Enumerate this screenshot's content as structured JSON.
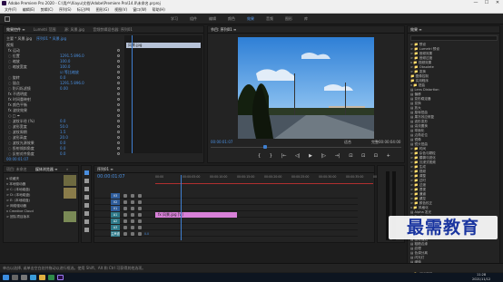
{
  "window": {
    "title": "Adobe Premiere Pro 2020 - C:\\用户\\Xiayu\\文档\\Adobe\\Premiere Pro\\14.0\\未命名.prproj",
    "minimize": "—",
    "maximize": "☐",
    "close": "✕"
  },
  "menu": [
    "文件(F)",
    "编辑(E)",
    "剪辑(C)",
    "序列(S)",
    "标记(M)",
    "图形(G)",
    "视图(V)",
    "窗口(W)",
    "帮助(H)"
  ],
  "workspaces": {
    "items": [
      "学习",
      "组件",
      "编辑",
      "颜色",
      "效果",
      "音频",
      "图形",
      "库"
    ],
    "active": 4
  },
  "effect_controls": {
    "tabs": [
      "效果控件 ≡",
      "Lumetri 范围",
      "源: 风景.jpg",
      "音频剪辑混合器: 序列01"
    ],
    "header": [
      "主要 * 风景.jpg",
      "序列01 * 风景.jpg"
    ],
    "clip_label": "风景.jpg",
    "section_video": "视频",
    "rows": [
      {
        "label": "fx  运动",
        "value": ""
      },
      {
        "label": "  ◌ 位置",
        "value": "1291.5    896.0"
      },
      {
        "label": "  ◌ 缩放",
        "value": "100.0"
      },
      {
        "label": "  ◌ 缩放宽度",
        "value": "100.0"
      },
      {
        "label": "",
        "value": "☑ 等比缩放"
      },
      {
        "label": "  ◌ 旋转",
        "value": "0.0"
      },
      {
        "label": "  ◌ 锚点",
        "value": "1291.5    896.0"
      },
      {
        "label": "  ◌ 防闪烁滤镜",
        "value": "0.00"
      },
      {
        "label": "fx  不透明度",
        "value": ""
      },
      {
        "label": "fx  时间重映射",
        "value": ""
      },
      {
        "label": "fx  颜色平衡",
        "value": ""
      },
      {
        "label": "fx  波纹效果",
        "value": ""
      },
      {
        "label": "  ○ □ ✒",
        "value": ""
      },
      {
        "label": "  ◌ 波纹半径 (%)",
        "value": "0.0"
      },
      {
        "label": "  ◌ 波形宽度",
        "value": "50.0"
      },
      {
        "label": "  ◌ 波纹周期",
        "value": "1.5"
      },
      {
        "label": "  ◌ 波形高度",
        "value": "20.0"
      },
      {
        "label": "  ◌ 波纹光源效果",
        "value": "0.0"
      },
      {
        "label": "  ◌ 投射倾斜角度",
        "value": "0.0"
      },
      {
        "label": "  ◌ 反射对齐角度",
        "value": "0.0"
      }
    ],
    "timecode": "00:00:01:07"
  },
  "program": {
    "tab": "节目: 序列01 ≡",
    "timecode": "00:00:01:07",
    "fit": "适合",
    "quality": "完整",
    "duration": "00:00:04:00",
    "controls": [
      "{",
      "}",
      "|←",
      "◁|",
      "▶",
      "|▷",
      "→|",
      "⊡",
      "⊡",
      "⊡",
      "+"
    ]
  },
  "effects": {
    "tab": "效果 ≡",
    "items": [
      {
        "label": "> 📁 预设",
        "selected": false
      },
      {
        "label": "> 📁 Lumetri 预设",
        "selected": false
      },
      {
        "label": "> 📁 音频效果",
        "selected": false
      },
      {
        "label": "> 📁 音频过渡",
        "selected": false
      },
      {
        "label": "v 📁 视频效果",
        "selected": false
      },
      {
        "label": "  > 📁 Obsolete",
        "selected": false
      },
      {
        "label": "  > 📁 变换",
        "selected": false
      },
      {
        "label": "    📁 图像控制",
        "selected": false
      },
      {
        "label": "    📁 实用程序",
        "selected": false
      },
      {
        "label": "  v 📁 扭曲",
        "selected": false
      },
      {
        "label": "      ▤ Lens Distortion",
        "selected": false
      },
      {
        "label": "      ▤ 偏移",
        "selected": false
      },
      {
        "label": "      ▤ 变形稳定器",
        "selected": false
      },
      {
        "label": "      ▤ 变换",
        "selected": false
      },
      {
        "label": "      ▤ 放大",
        "selected": false
      },
      {
        "label": "      ▤ 旋转扭曲",
        "selected": false
      },
      {
        "label": "      ▤ 果冻效应修复",
        "selected": false
      },
      {
        "label": "      ▤ 波形变形",
        "selected": false
      },
      {
        "label": "      ▤ 湍流置换",
        "selected": false
      },
      {
        "label": "      ▤ 球面化",
        "selected": false
      },
      {
        "label": "      ▤ 边角定位",
        "selected": false
      },
      {
        "label": "      ▤ 镜像",
        "selected": false
      },
      {
        "label": "      ▤ 镜头扭曲",
        "selected": false
      },
      {
        "label": "  > 📁 时间",
        "selected": false
      },
      {
        "label": "  > 📁 杂色与颗粒",
        "selected": false
      },
      {
        "label": "  > 📁 模糊与锐化",
        "selected": false
      },
      {
        "label": "  > 📁 沉浸式视频",
        "selected": false
      },
      {
        "label": "  > 📁 生成",
        "selected": false
      },
      {
        "label": "  > 📁 视频",
        "selected": false
      },
      {
        "label": "  > 📁 调整",
        "selected": false
      },
      {
        "label": "  > 📁 过时",
        "selected": false
      },
      {
        "label": "  > 📁 过渡",
        "selected": false
      },
      {
        "label": "  > 📁 透视",
        "selected": false
      },
      {
        "label": "  > 📁 通道",
        "selected": false
      },
      {
        "label": "  > 📁 键控",
        "selected": false
      },
      {
        "label": "  > 📁 颜色校正",
        "selected": false
      },
      {
        "label": "  v 📁 风格化",
        "selected": false
      },
      {
        "label": "      ▤ Alpha 发光",
        "selected": false
      },
      {
        "label": "      ▤ Replicate",
        "selected": false
      },
      {
        "label": "      ▤ 彩色浮雕",
        "selected": false
      },
      {
        "label": "      ▤ 曝光过度",
        "selected": false
      },
      {
        "label": "      ▤ 查找边缘",
        "selected": false
      },
      {
        "label": "      ▤ 浮雕",
        "selected": false
      },
      {
        "label": "      ▤ 画笔描边",
        "selected": false
      },
      {
        "label": "      ▤ 粗糙边缘",
        "selected": false
      },
      {
        "label": "      ▤ 纹理",
        "selected": false
      },
      {
        "label": "      ▤ 色调分离",
        "selected": false
      },
      {
        "label": "      ▤ 闪光灯",
        "selected": false
      },
      {
        "label": "      ▤ 阈值",
        "selected": false
      },
      {
        "label": "      ▤ 马赛克",
        "selected": false
      },
      {
        "label": "> 📁 视频过渡",
        "selected": false
      }
    ]
  },
  "project": {
    "tabs": [
      "项目: 未命名",
      "媒体浏览器 ≡",
      "»"
    ],
    "path": "未命名.prproj",
    "count": "1 项已选择, 共 3 项",
    "tree": [
      {
        "label": "v 收藏夹",
        "selected": false
      },
      {
        "label": "v 本地驱动器",
        "selected": false
      },
      {
        "label": "  > C: (本地磁盘)",
        "selected": false
      },
      {
        "label": "  > D: (本地磁盘)",
        "selected": false
      },
      {
        "label": "  > E: (本地磁盘)",
        "selected": false
      },
      {
        "label": "> 网络驱动器",
        "selected": false
      },
      {
        "label": "v Creative Cloud",
        "selected": false
      },
      {
        "label": "  > 团队项目版本",
        "selected": false
      }
    ],
    "thumbs": [
      "风景.jpg",
      "序列01",
      "素材.mp4"
    ]
  },
  "timeline": {
    "tab": "序列01 ≡",
    "timecode": "00:00:01:07",
    "ruler": [
      "00:00",
      "00:00:05:00",
      "00:00:10:00",
      "00:00:15:00",
      "00:00:20:00",
      "00:00:25:00",
      "00:00:30:00",
      "00:00:35:00",
      "00:00:40:00"
    ],
    "tracks": [
      "V3",
      "V2",
      "V1",
      "A1",
      "A2",
      "A3",
      "主声道"
    ],
    "master_value": "0.0",
    "clip_label": "fx 风景.jpg [V]"
  },
  "status": "单击以选择, 或单击空白处并拖动以进行框选。使用 Shift、Alt 和 Ctrl 可获得其他选项。",
  "taskbar": {
    "time": "11:28",
    "date": "2021/11/12"
  },
  "watermark": "最需教育"
}
